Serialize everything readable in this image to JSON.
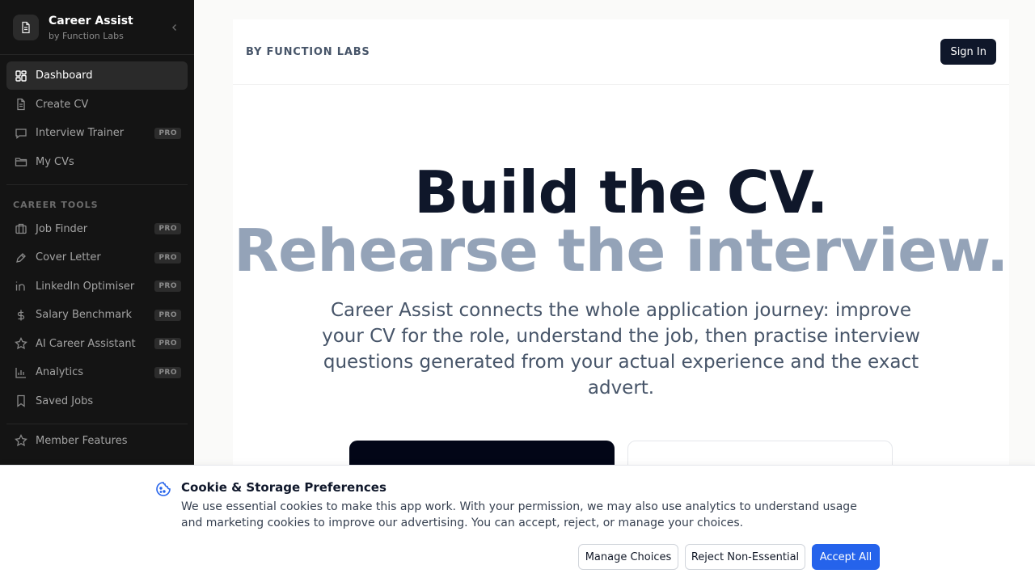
{
  "brand": {
    "title": "Career Assist",
    "subtitle": "by Function Labs"
  },
  "nav": {
    "main": [
      {
        "label": "Dashboard",
        "icon": "grid-icon",
        "active": true
      },
      {
        "label": "Create CV",
        "icon": "document-icon"
      },
      {
        "label": "Interview Trainer",
        "icon": "chat-icon",
        "badge": "PRO"
      },
      {
        "label": "My CVs",
        "icon": "folder-icon"
      }
    ],
    "section_label": "CAREER TOOLS",
    "tools": [
      {
        "label": "Job Finder",
        "icon": "briefcase-icon",
        "badge": "PRO"
      },
      {
        "label": "Cover Letter",
        "icon": "pen-icon",
        "badge": "PRO"
      },
      {
        "label": "LinkedIn Optimiser",
        "icon": "linkedin-icon",
        "badge": "PRO"
      },
      {
        "label": "Salary Benchmark",
        "icon": "dollar-icon",
        "badge": "PRO"
      },
      {
        "label": "AI Career Assistant",
        "icon": "star-icon",
        "badge": "PRO"
      },
      {
        "label": "Analytics",
        "icon": "bar-chart-icon",
        "badge": "PRO"
      },
      {
        "label": "Saved Jobs",
        "icon": "bookmark-icon"
      }
    ],
    "member": {
      "label": "Member Features",
      "icon": "star-icon"
    }
  },
  "header": {
    "tag": "BY FUNCTION LABS",
    "signin_label": "Sign In"
  },
  "hero": {
    "line1": "Build the CV.",
    "line2": "Rehearse the interview.",
    "lead": "Career Assist connects the whole application journey: improve your CV for the role, understand the job, then practise interview questions generated from your actual experience and the exact advert."
  },
  "cookie": {
    "title": "Cookie & Storage Preferences",
    "text": "We use essential cookies to make this app work. With your permission, we may also use analytics to understand usage and marketing cookies to improve our advertising. You can accept, reject, or manage your choices.",
    "manage_label": "Manage Choices",
    "reject_label": "Reject Non-Essential",
    "accept_label": "Accept All"
  },
  "colors": {
    "sidebar_bg": "#141414",
    "accent": "#2563eb",
    "hero_muted": "#94a3b8",
    "dark": "#0f172a"
  }
}
